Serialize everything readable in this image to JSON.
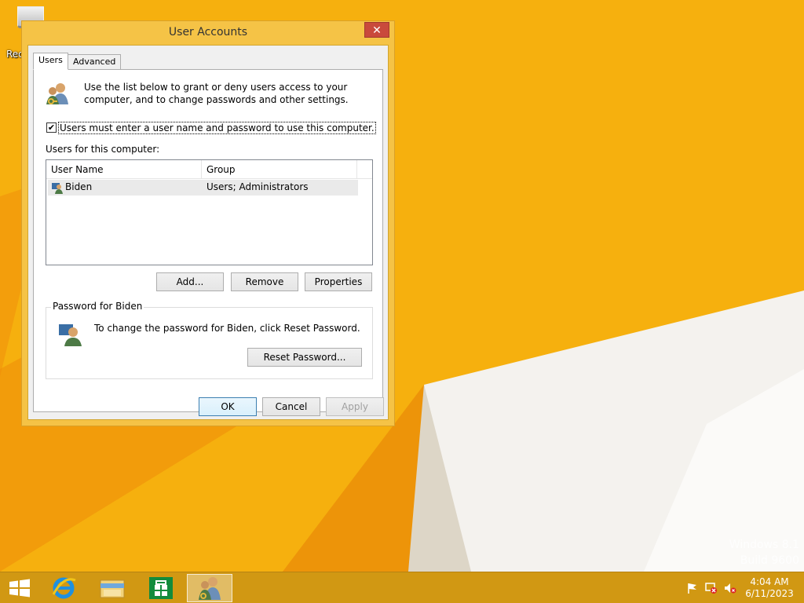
{
  "desktop": {
    "recycle_bin_label": "Rec",
    "watermark_line1": "Windows 8.1",
    "watermark_line2": "Build 9600"
  },
  "dialog": {
    "title": "User Accounts",
    "tabs": [
      "Users",
      "Advanced"
    ],
    "intro_text": "Use the list below to grant or deny users access to your computer, and to change passwords and other settings.",
    "require_login_label": "Users must enter a user name and password to use this computer.",
    "require_login_checked": true,
    "users_label": "Users for this computer:",
    "columns": [
      "User Name",
      "Group"
    ],
    "users": [
      {
        "name": "Biden",
        "group": "Users; Administrators"
      }
    ],
    "buttons": {
      "add": "Add...",
      "remove": "Remove",
      "properties": "Properties",
      "reset_password": "Reset Password...",
      "ok": "OK",
      "cancel": "Cancel",
      "apply": "Apply"
    },
    "password_group_label": "Password for Biden",
    "password_text": "To change the password for Biden, click Reset Password."
  },
  "taskbar": {
    "time": "4:04 AM",
    "date": "6/11/2023"
  },
  "colors": {
    "wallpaper": "#f6b00e",
    "dialog_frame": "#f5c346",
    "close_button": "#c94a3c",
    "taskbar": "#cd9614"
  }
}
